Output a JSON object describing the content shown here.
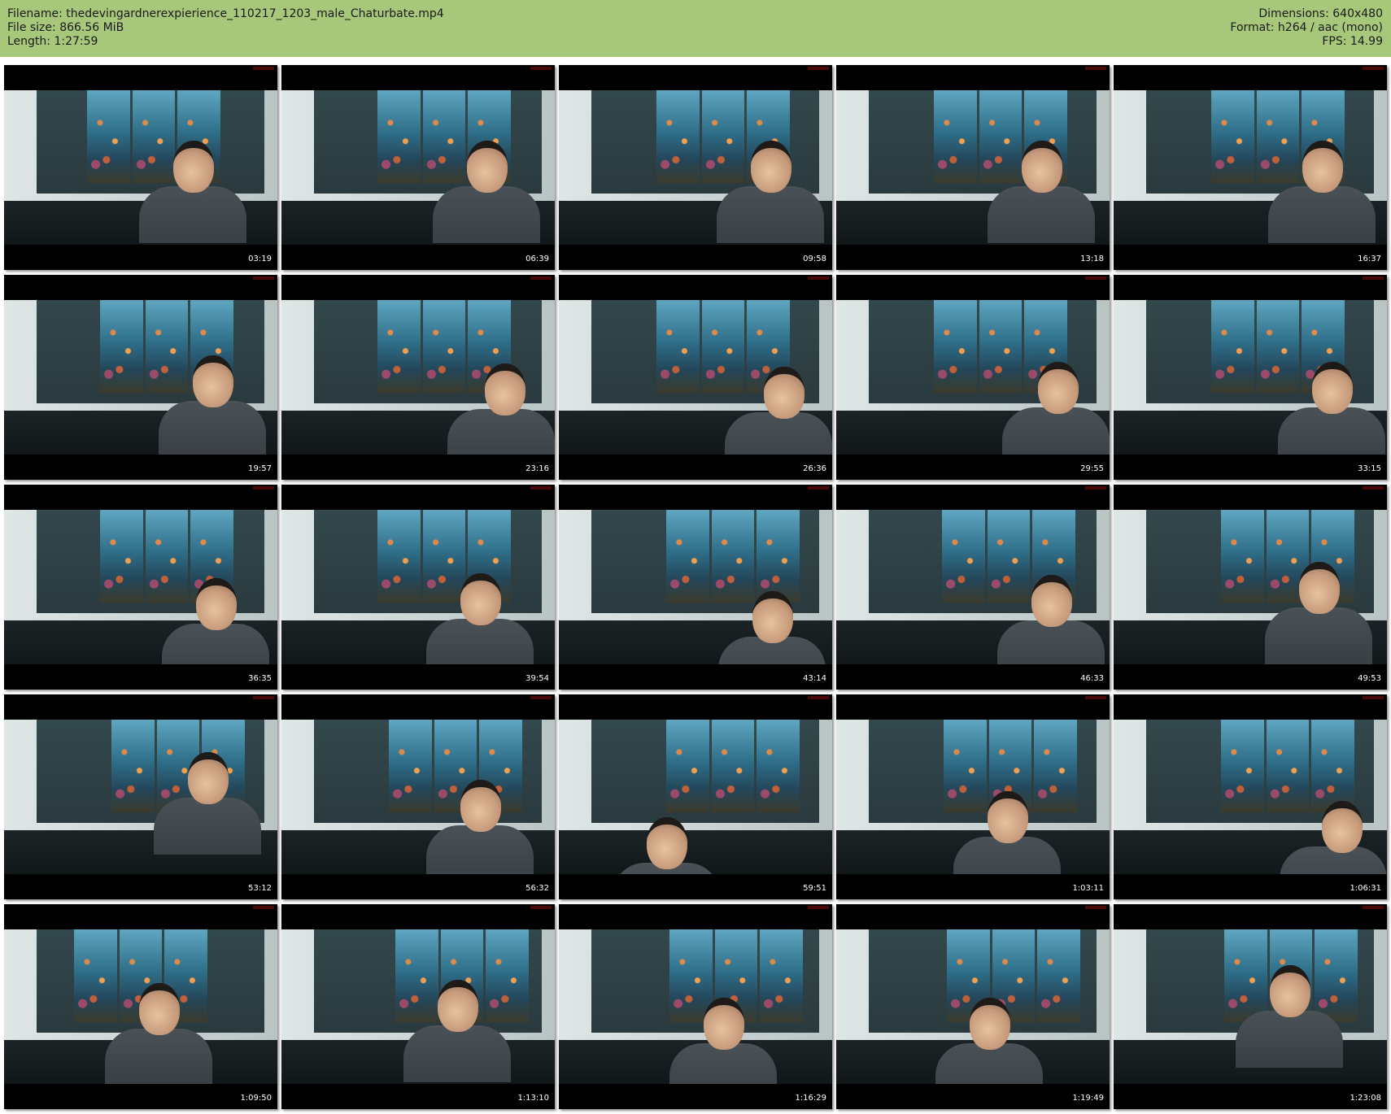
{
  "header": {
    "filename": "Filename: thedevingardnerexpierience_110217_1203_male_Chaturbate.mp4",
    "file_size": "File size: 866.56 MiB",
    "length": "Length: 1:27:59",
    "dimensions": "Dimensions: 640x480",
    "format": "Format: h264 / aac (mono)",
    "fps": "FPS: 14.99",
    "background_color": "#a7c77b"
  },
  "thumbnails": [
    {
      "timestamp": "03:19"
    },
    {
      "timestamp": "06:39"
    },
    {
      "timestamp": "09:58"
    },
    {
      "timestamp": "13:18"
    },
    {
      "timestamp": "16:37"
    },
    {
      "timestamp": "19:57"
    },
    {
      "timestamp": "23:16"
    },
    {
      "timestamp": "26:36"
    },
    {
      "timestamp": "29:55"
    },
    {
      "timestamp": "33:15"
    },
    {
      "timestamp": "36:35"
    },
    {
      "timestamp": "39:54"
    },
    {
      "timestamp": "43:14"
    },
    {
      "timestamp": "46:33"
    },
    {
      "timestamp": "49:53"
    },
    {
      "timestamp": "53:12"
    },
    {
      "timestamp": "56:32"
    },
    {
      "timestamp": "59:51"
    },
    {
      "timestamp": "1:03:11"
    },
    {
      "timestamp": "1:06:31"
    },
    {
      "timestamp": "1:09:50"
    },
    {
      "timestamp": "1:13:10"
    },
    {
      "timestamp": "1:16:29"
    },
    {
      "timestamp": "1:19:49"
    },
    {
      "timestamp": "1:23:08"
    }
  ]
}
